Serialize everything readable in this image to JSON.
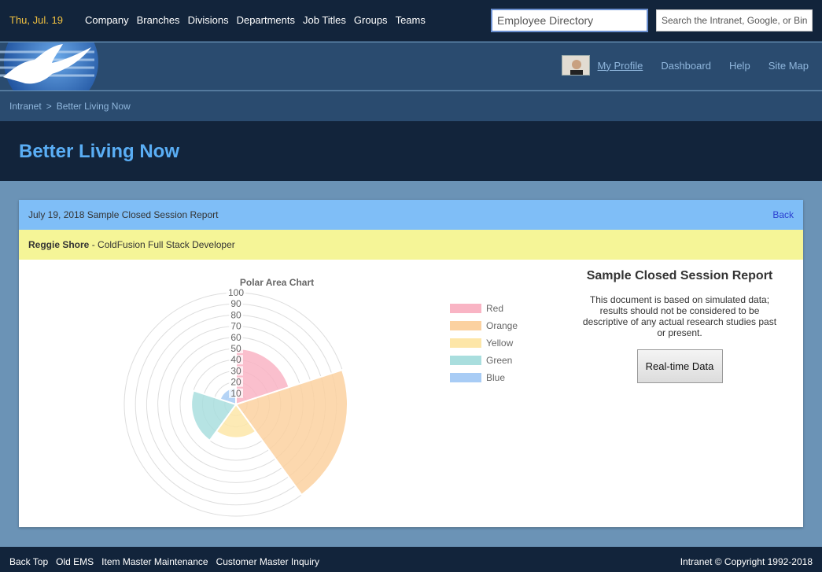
{
  "topbar": {
    "date": "Thu, Jul. 19",
    "nav": [
      "Company",
      "Branches",
      "Divisions",
      "Departments",
      "Job Titles",
      "Groups",
      "Teams"
    ],
    "employee_placeholder": "Employee Directory",
    "search_placeholder": "Search the Intranet, Google, or Bing"
  },
  "profile_nav": {
    "my_profile": "My Profile",
    "dashboard": "Dashboard",
    "help": "Help",
    "site_map": "Site Map"
  },
  "breadcrumb": {
    "root": "Intranet",
    "separator": ">",
    "current": "Better Living Now"
  },
  "page_title": "Better Living Now",
  "card": {
    "header": "July 19, 2018 Sample Closed Session Report",
    "back": "Back",
    "person_name": "Reggie Shore",
    "person_role": " - ColdFusion Full Stack Developer"
  },
  "report": {
    "title": "Sample Closed Session Report",
    "description": "This document is based on simulated data; results should not be considered to be descriptive of any actual research studies past or present.",
    "button": "Real-time Data"
  },
  "chart_data": {
    "type": "polarArea",
    "title": "Polar Area Chart",
    "categories": [
      "Red",
      "Orange",
      "Yellow",
      "Green",
      "Blue"
    ],
    "values": [
      50,
      100,
      30,
      40,
      15
    ],
    "colors": [
      "#f9b4c4",
      "#fbd1a0",
      "#fde6a8",
      "#a9dede",
      "#a8ccf5"
    ],
    "r_ticks": [
      10,
      20,
      30,
      40,
      50,
      60,
      70,
      80,
      90,
      100
    ],
    "r_range": [
      0,
      100
    ],
    "legend_position": "right"
  },
  "footer": {
    "links": [
      "Back Top",
      "Old EMS",
      "Item Master Maintenance",
      "Customer Master Inquiry"
    ],
    "copyright": "Intranet © Copyright 1992-2018"
  }
}
